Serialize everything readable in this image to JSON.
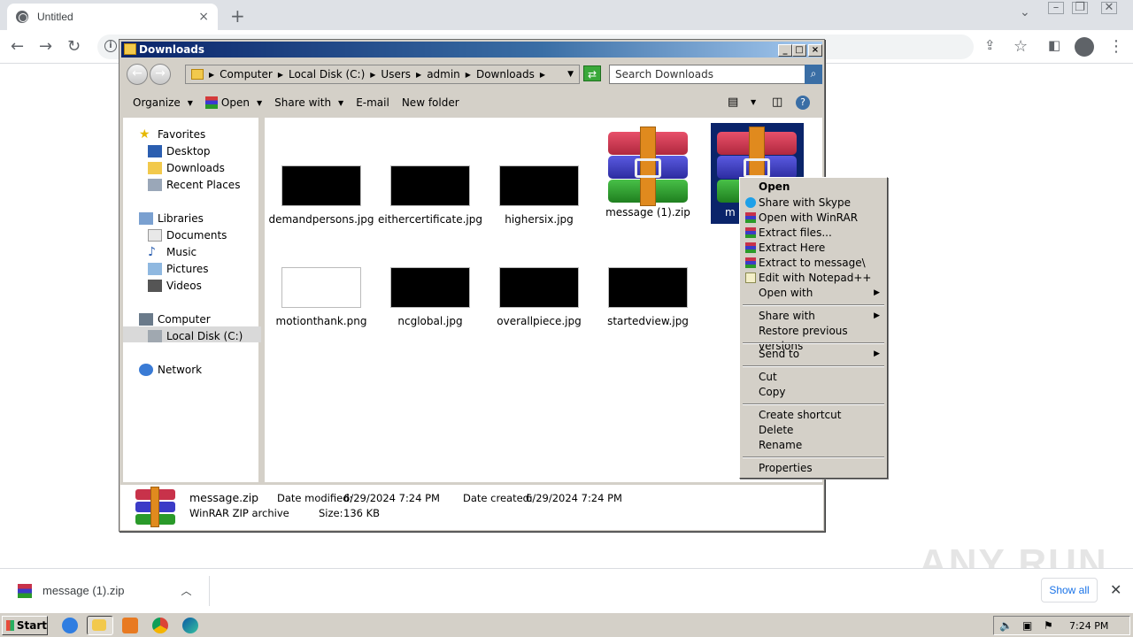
{
  "browser": {
    "tab_title": "Untitled",
    "tab_close": "×",
    "new_tab": "+"
  },
  "explorer": {
    "title": "Downloads",
    "breadcrumb": [
      "Computer",
      "Local Disk (C:)",
      "Users",
      "admin",
      "Downloads"
    ],
    "search_placeholder": "Search Downloads",
    "commands": {
      "organize": "Organize",
      "open": "Open",
      "share_with": "Share with",
      "email": "E-mail",
      "new_folder": "New folder"
    },
    "nav": {
      "favorites": "Favorites",
      "desktop": "Desktop",
      "downloads": "Downloads",
      "recent_places": "Recent Places",
      "libraries": "Libraries",
      "documents": "Documents",
      "music": "Music",
      "pictures": "Pictures",
      "videos": "Videos",
      "computer": "Computer",
      "local_disk": "Local Disk (C:)",
      "network": "Network"
    },
    "files": [
      {
        "name": "demandpersons.jpg"
      },
      {
        "name": "eithercertificate.jpg"
      },
      {
        "name": "highersix.jpg"
      },
      {
        "name": "message (1).zip"
      },
      {
        "name": "m"
      },
      {
        "name": "motionthank.png"
      },
      {
        "name": "ncglobal.jpg"
      },
      {
        "name": "overallpiece.jpg"
      },
      {
        "name": "startedview.jpg"
      }
    ],
    "details": {
      "name": "message.zip",
      "type": "WinRAR ZIP archive",
      "modified_label": "Date modified:",
      "modified": "6/29/2024 7:24 PM",
      "created_label": "Date created:",
      "created": "6/29/2024 7:24 PM",
      "size_label": "Size:",
      "size": "136 KB"
    }
  },
  "context_menu": {
    "open": "Open",
    "share_skype": "Share with Skype",
    "open_winrar": "Open with WinRAR",
    "extract_files": "Extract files...",
    "extract_here": "Extract Here",
    "extract_to": "Extract to message\\",
    "edit_notepad": "Edit with Notepad++",
    "open_with": "Open with",
    "share_with": "Share with",
    "restore": "Restore previous versions",
    "send_to": "Send to",
    "cut": "Cut",
    "copy": "Copy",
    "create_shortcut": "Create shortcut",
    "delete": "Delete",
    "rename": "Rename",
    "properties": "Properties"
  },
  "downloads_bar": {
    "item": "message (1).zip",
    "show_all": "Show all"
  },
  "taskbar": {
    "start": "Start",
    "clock": "7:24 PM"
  },
  "watermark": "ANY RUN"
}
